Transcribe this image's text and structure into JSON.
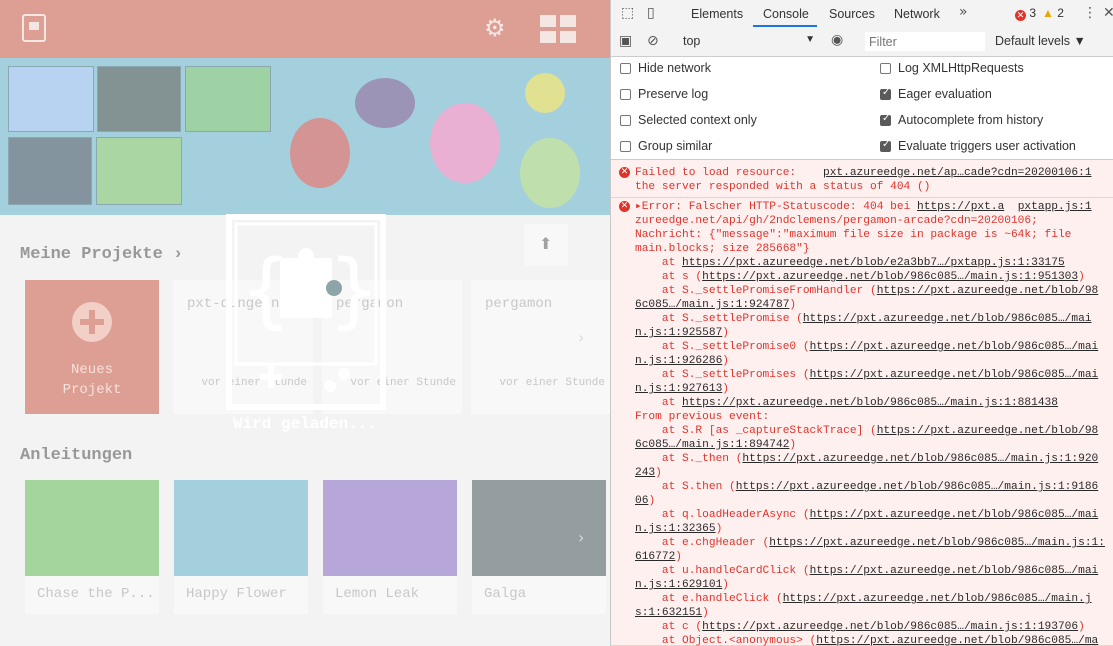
{
  "app": {
    "gear_glyph": "⚙",
    "projects_heading": "Meine Projekte ›",
    "new_project": {
      "label": "Neues\nProjekt"
    },
    "projects": [
      {
        "title": "pxt-dungeon",
        "time": "vor einer Stunde"
      },
      {
        "title": "pergamon",
        "time": "vor einer Stunde"
      },
      {
        "title": "pergamon",
        "time": "vor einer Stunde"
      }
    ],
    "tutorials_heading": "Anleitungen",
    "tutorials": [
      {
        "label": "Chase the P...",
        "bg": "#58b24c"
      },
      {
        "label": "Happy Flower",
        "bg": "#5aa9c2"
      },
      {
        "label": "Lemon Leak",
        "bg": "#7b5fb8"
      },
      {
        "label": "Galga",
        "bg": "#3d4d52"
      }
    ],
    "loading_text": "Wird geladen...",
    "colors": {
      "header": "#c2503d",
      "hero": "#5aa9c2"
    }
  },
  "devtools": {
    "tabs": [
      "Elements",
      "Console",
      "Sources",
      "Network"
    ],
    "more_tabs_glyph": "»",
    "error_count": "3",
    "warning_count": "2",
    "menu_glyph": "⋮",
    "close_glyph": "✕",
    "context": "top",
    "filter_placeholder": "Filter",
    "levels": "Default levels ▼",
    "settings_left": [
      {
        "label": "Hide network",
        "checked": false
      },
      {
        "label": "Preserve log",
        "checked": false
      },
      {
        "label": "Selected context only",
        "checked": false
      },
      {
        "label": "Group similar",
        "checked": false
      }
    ],
    "settings_right": [
      {
        "label": "Log XMLHttpRequests",
        "checked": false
      },
      {
        "label": "Eager evaluation",
        "checked": true
      },
      {
        "label": "Autocomplete from history",
        "checked": true
      },
      {
        "label": "Evaluate triggers user activation",
        "checked": true
      }
    ],
    "messages": [
      {
        "lines": [
          [
            {
              "t": "Failed to load resource:    "
            },
            {
              "t": "pxt.azureedge.net/ap…cade?cdn=20200106:1",
              "u": true
            }
          ],
          [
            {
              "t": "the server responded with a status of 404 ()"
            }
          ]
        ]
      },
      {
        "lines": [
          [
            {
              "t": "▸Error: Falscher HTTP-Statuscode: 404 bei "
            },
            {
              "t": "https://pxt.a",
              "u": true
            },
            {
              "t": "  "
            },
            {
              "t": "pxtapp.js:1",
              "u": true
            }
          ],
          [
            {
              "t": "zureedge.net/api/gh/2ndclemens/pergamon-arcade?cdn=20200106;"
            }
          ],
          [
            {
              "t": "Nachricht: {\"message\":\"maximum file size in package is ~64k; file"
            }
          ],
          [
            {
              "t": "main.blocks; size 285668\"}"
            }
          ],
          [
            {
              "t": "    at "
            },
            {
              "t": "https://pxt.azureedge.net/blob/e2a3bb7…/pxtapp.js:1:33175",
              "u": true
            }
          ],
          [
            {
              "t": "    at s ("
            },
            {
              "t": "https://pxt.azureedge.net/blob/986c085…/main.js:1:951303",
              "u": true
            },
            {
              "t": ")"
            }
          ],
          [
            {
              "t": "    at S._settlePromiseFromHandler ("
            },
            {
              "t": "https://pxt.azureedge.net/blob/98",
              "u": true
            }
          ],
          [
            {
              "t": "6c085…/main.js:1:924787",
              "u": true
            },
            {
              "t": ")"
            }
          ],
          [
            {
              "t": "    at S._settlePromise ("
            },
            {
              "t": "https://pxt.azureedge.net/blob/986c085…/mai",
              "u": true
            }
          ],
          [
            {
              "t": "n.js:1:925587",
              "u": true
            },
            {
              "t": ")"
            }
          ],
          [
            {
              "t": "    at S._settlePromise0 ("
            },
            {
              "t": "https://pxt.azureedge.net/blob/986c085…/mai",
              "u": true
            }
          ],
          [
            {
              "t": "n.js:1:926286",
              "u": true
            },
            {
              "t": ")"
            }
          ],
          [
            {
              "t": "    at S._settlePromises ("
            },
            {
              "t": "https://pxt.azureedge.net/blob/986c085…/mai",
              "u": true
            }
          ],
          [
            {
              "t": "n.js:1:927613",
              "u": true
            },
            {
              "t": ")"
            }
          ],
          [
            {
              "t": "    at "
            },
            {
              "t": "https://pxt.azureedge.net/blob/986c085…/main.js:1:881438",
              "u": true
            }
          ],
          [
            {
              "t": "From previous event:"
            }
          ],
          [
            {
              "t": "    at S.R [as _captureStackTrace] ("
            },
            {
              "t": "https://pxt.azureedge.net/blob/98",
              "u": true
            }
          ],
          [
            {
              "t": "6c085…/main.js:1:894742",
              "u": true
            },
            {
              "t": ")"
            }
          ],
          [
            {
              "t": "    at S._then ("
            },
            {
              "t": "https://pxt.azureedge.net/blob/986c085…/main.js:1:920",
              "u": true
            }
          ],
          [
            {
              "t": "243",
              "u": true
            },
            {
              "t": ")"
            }
          ],
          [
            {
              "t": "    at S.then ("
            },
            {
              "t": "https://pxt.azureedge.net/blob/986c085…/main.js:1:9186",
              "u": true
            }
          ],
          [
            {
              "t": "06",
              "u": true
            },
            {
              "t": ")"
            }
          ],
          [
            {
              "t": "    at q.loadHeaderAsync ("
            },
            {
              "t": "https://pxt.azureedge.net/blob/986c085…/mai",
              "u": true
            }
          ],
          [
            {
              "t": "n.js:1:32365",
              "u": true
            },
            {
              "t": ")"
            }
          ],
          [
            {
              "t": "    at e.chgHeader ("
            },
            {
              "t": "https://pxt.azureedge.net/blob/986c085…/main.js:1:",
              "u": true
            }
          ],
          [
            {
              "t": "616772",
              "u": true
            },
            {
              "t": ")"
            }
          ],
          [
            {
              "t": "    at u.handleCardClick ("
            },
            {
              "t": "https://pxt.azureedge.net/blob/986c085…/mai",
              "u": true
            }
          ],
          [
            {
              "t": "n.js:1:629101",
              "u": true
            },
            {
              "t": ")"
            }
          ],
          [
            {
              "t": "    at e.handleClick ("
            },
            {
              "t": "https://pxt.azureedge.net/blob/986c085…/main.j",
              "u": true
            }
          ],
          [
            {
              "t": "s:1:632151",
              "u": true
            },
            {
              "t": ")"
            }
          ],
          [
            {
              "t": "    at c ("
            },
            {
              "t": "https://pxt.azureedge.net/blob/986c085…/main.js:1:193706",
              "u": true
            },
            {
              "t": ")"
            }
          ],
          [
            {
              "t": "    at Object.<anonymous> ("
            },
            {
              "t": "https://pxt.azureedge.net/blob/986c085…/ma",
              "u": true
            }
          ]
        ]
      }
    ]
  }
}
